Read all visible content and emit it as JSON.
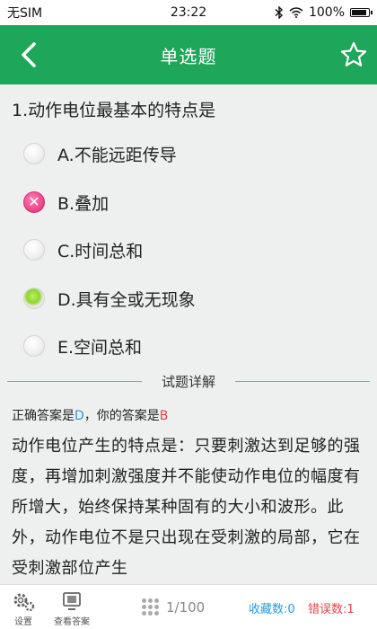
{
  "status": {
    "carrier": "无SIM",
    "time": "23:22",
    "battery": "100%",
    "battery_level": 1.0
  },
  "nav": {
    "title": "单选题",
    "back_icon": "chevron-left-icon",
    "star_icon": "star-outline-icon"
  },
  "question": {
    "text": "1.动作电位最基本的特点是"
  },
  "options": [
    {
      "label": "A.不能远距传导",
      "state": "unselected"
    },
    {
      "label": "B.叠加",
      "state": "wrong-selected"
    },
    {
      "label": "C.时间总和",
      "state": "unselected"
    },
    {
      "label": "D.具有全或无现象",
      "state": "correct"
    },
    {
      "label": "E.空间总和",
      "state": "unselected"
    }
  ],
  "detail": {
    "heading": "试题详解",
    "correct_prefix": "正确答案是",
    "correct_answer": "D",
    "separator": "，",
    "yours_prefix": "你的答案是",
    "your_answer": "B",
    "explanation": "动作电位产生的特点是：只要刺激达到足够的强度，再增加刺激强度并不能使动作电位的幅度有所增大，始终保持某种固有的大小和波形。此外，动作电位不是只出现在受刺激的局部，它在受刺激部位产生"
  },
  "bottom": {
    "settings_label": "设置",
    "view_answer_label": "查看答案",
    "progress": "1/100",
    "favorites": "收藏数:0",
    "errors": "错误数:1"
  },
  "colors": {
    "accent": "#1ea65a",
    "blue": "#2a9bd8",
    "red": "#e24646",
    "wrong": "#ee3f86",
    "correct": "#8fd62c"
  }
}
